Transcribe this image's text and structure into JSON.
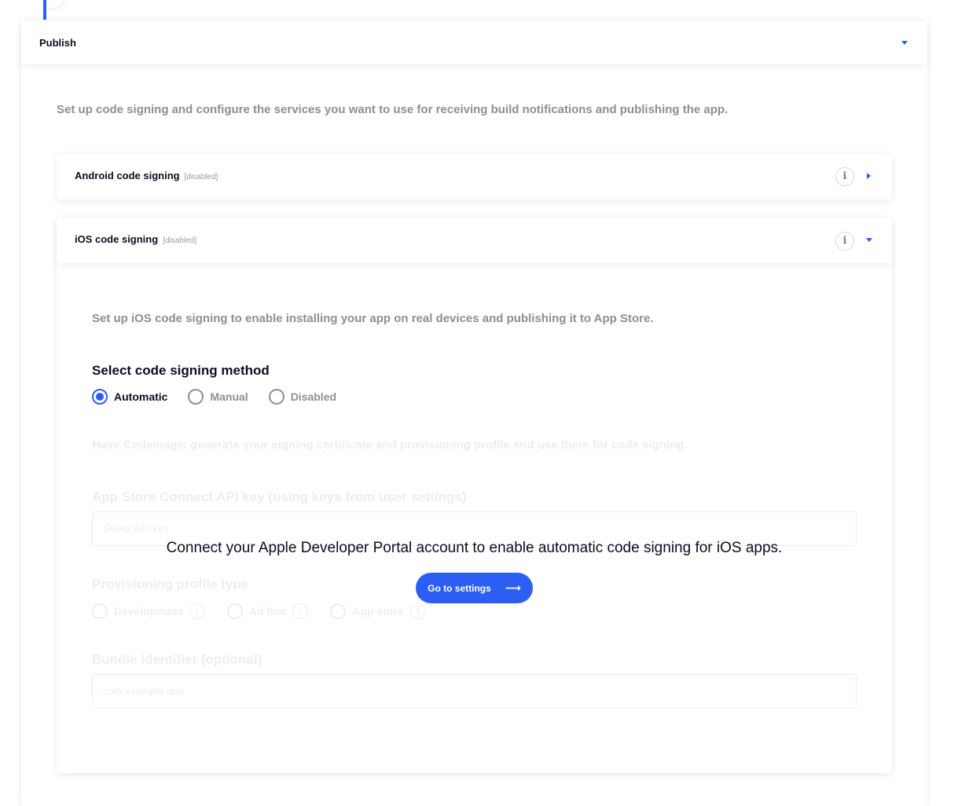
{
  "publish": {
    "title": "Publish",
    "description": "Set up code signing and configure the services you want to use for receiving build notifications and publishing the app."
  },
  "android": {
    "title": "Android code signing",
    "badge": "[disabled]"
  },
  "ios": {
    "title": "iOS code signing",
    "badge": "[disabled]",
    "description": "Set up iOS code signing to enable installing your app on real devices and publishing it to App Store.",
    "method_heading": "Select code signing method",
    "methods": {
      "automatic": "Automatic",
      "manual": "Manual",
      "disabled": "Disabled"
    },
    "selected_method": "Automatic",
    "faded_form": {
      "intro": "Have Codemagic generate your signing certificate and provisioning profile and use them for code signing.",
      "api_key_label": "App Store Connect API key (using keys from user settings)",
      "api_key_placeholder": "Select API key",
      "profile_type_label": "Provisioning profile type",
      "profile_types": {
        "development": "Development",
        "ad_hoc": "Ad hoc",
        "app_store": "App store"
      },
      "bundle_label": "Bundle identifier (optional)",
      "bundle_placeholder": "com.example.app"
    },
    "overlay_message": "Connect your Apple Developer Portal account to enable automatic code signing for iOS apps.",
    "settings_button": "Go to settings",
    "settings_arrow": "⟶"
  },
  "icons": {
    "info": "info-icon",
    "expand_down": "caret-down-icon",
    "expand_right": "caret-right-icon",
    "info_glyph": "i"
  },
  "colors": {
    "accent": "#2c5ef3",
    "muted_text": "#8e8e96",
    "heading_text": "#0d0d1f"
  }
}
